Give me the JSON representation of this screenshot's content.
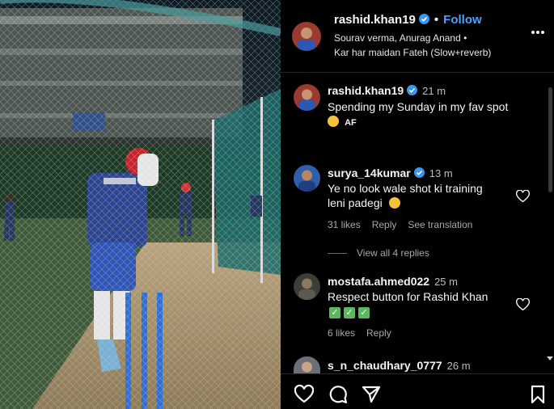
{
  "header": {
    "username": "rashid.khan19",
    "follow_label": "Follow",
    "audio_artists": "Sourav verma, Anurag Anand •",
    "audio_track": "Kar har maidan Fateh (Slow+reverb)"
  },
  "caption": {
    "username": "rashid.khan19",
    "time": "21 m",
    "text": "Spending my Sunday in my fav spot",
    "tag": "AF"
  },
  "comments": [
    {
      "username": "surya_14kumar",
      "time": "13 m",
      "line1": "Ye no look wale shot ki training",
      "line2": "leni padegi",
      "likes": "31 likes",
      "reply": "Reply",
      "translate": "See translation",
      "view_replies": "View all 4 replies"
    },
    {
      "username": "mostafa.ahmed022",
      "time": "25 m",
      "line1": "Respect button for Rashid Khan",
      "likes": "6 likes",
      "reply": "Reply"
    },
    {
      "username": "s_n_chaudhary_0777",
      "time": "26 m"
    }
  ],
  "colors": {
    "follow": "#4aa3ff",
    "verified": "#3897f0",
    "background": "#000000"
  },
  "icons": [
    "verified-icon",
    "more-options-icon",
    "heart-icon",
    "comment-icon",
    "share-icon",
    "bookmark-icon"
  ]
}
